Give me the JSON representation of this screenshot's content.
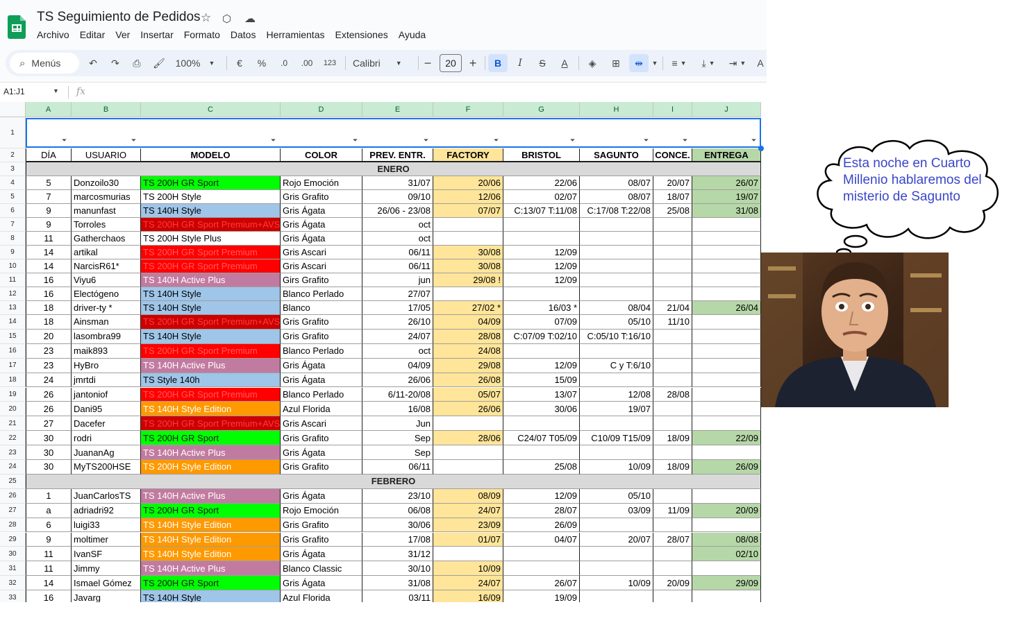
{
  "app": {
    "title": "TS Seguimiento de Pedidos",
    "menu": [
      "Archivo",
      "Editar",
      "Ver",
      "Insertar",
      "Formato",
      "Datos",
      "Herramientas",
      "Extensiones",
      "Ayuda"
    ]
  },
  "toolbar": {
    "search_label": "Menús",
    "zoom": "100%",
    "currency": "€",
    "percent": "%",
    "dec_decrease": ".0",
    "dec_increase": ".00",
    "number_format": "123",
    "font": "Calibri",
    "font_size": "20"
  },
  "formula_bar": {
    "name_box": "A1:J1",
    "fx": "fx"
  },
  "columns": [
    "A",
    "B",
    "C",
    "D",
    "E",
    "F",
    "G",
    "H",
    "I",
    "J"
  ],
  "headers": [
    "DÍA",
    "USUARIO",
    "MODELO",
    "COLOR",
    "PREV. ENTR.",
    "FACTORY",
    "BRISTOL",
    "SAGUNTO",
    "CONCE.",
    "ENTREGA"
  ],
  "row_numbers": [
    "1",
    "2",
    "3",
    "4",
    "5",
    "6",
    "7",
    "8",
    "9",
    "10",
    "11",
    "12",
    "13",
    "14",
    "15",
    "16",
    "17",
    "18",
    "19",
    "20",
    "21",
    "22",
    "23",
    "24",
    "25",
    "26",
    "27",
    "28",
    "29",
    "30",
    "31",
    "32",
    "33"
  ],
  "colors": {
    "green": "#00ff00",
    "red": "#ff0000",
    "darkred": "#cc0000",
    "blue": "#9fc5e8",
    "purple": "#c27ba0",
    "orange": "#ff9900",
    "factory": "#ffe599",
    "entrega": "#b6d7a8",
    "month": "#d9d9d9"
  },
  "months": {
    "enero": "ENERO",
    "febrero": "FEBRERO"
  },
  "rows": [
    {
      "r": 4,
      "dia": "5",
      "usuario": "Donzoilo30",
      "modelo": "TS 200H GR Sport",
      "m": "green",
      "color": "Rojo Emoción",
      "prev": "31/07",
      "factory": "20/06",
      "bristol": "22/06",
      "sagunto": "08/07",
      "conce": "20/07",
      "entrega": "26/07"
    },
    {
      "r": 5,
      "dia": "7",
      "usuario": "marcosmurias",
      "modelo": "TS 200H Style",
      "m": "",
      "color": "Gris Grafito",
      "prev": "09/10",
      "factory": "12/06",
      "bristol": "02/07",
      "sagunto": "08/07",
      "conce": "18/07",
      "entrega": "19/07"
    },
    {
      "r": 6,
      "dia": "9",
      "usuario": "manunfast",
      "modelo": "TS 140H Style",
      "m": "blue",
      "color": "Gris Ágata",
      "prev": "26/06 - 23/08",
      "factory": "07/07",
      "bristol": "C:13/07 T:11/08",
      "sagunto": "C:17/08 T:22/08",
      "conce": "25/08",
      "entrega": "31/08"
    },
    {
      "r": 7,
      "dia": "9",
      "usuario": "Torroles",
      "modelo": "TS 200H GR Sport Premium+AVS",
      "m": "darkred",
      "color": "Gris Ágata",
      "prev": "oct",
      "factory": "",
      "bristol": "",
      "sagunto": "",
      "conce": "",
      "entrega": ""
    },
    {
      "r": 8,
      "dia": "11",
      "usuario": "Gatherchaos",
      "modelo": "TS 200H Style Plus",
      "m": "",
      "color": "Gris Ágata",
      "prev": "oct",
      "factory": "",
      "bristol": "",
      "sagunto": "",
      "conce": "",
      "entrega": ""
    },
    {
      "r": 9,
      "dia": "14",
      "usuario": "artikal",
      "modelo": "TS 200H GR Sport Premium",
      "m": "red",
      "color": "Gris Ascari",
      "prev": "06/11",
      "factory": "30/08",
      "bristol": "12/09",
      "sagunto": "",
      "conce": "",
      "entrega": ""
    },
    {
      "r": 10,
      "dia": "14",
      "usuario": "NarcisR61*",
      "modelo": "TS 200H GR Sport Premium",
      "m": "red",
      "color": "Gris Ascari",
      "prev": "06/11",
      "factory": "30/08",
      "bristol": "12/09",
      "sagunto": "",
      "conce": "",
      "entrega": ""
    },
    {
      "r": 11,
      "dia": "16",
      "usuario": "Viyu6",
      "modelo": "TS 140H Active Plus",
      "m": "purple",
      "color": "Girs Grafito",
      "prev": "jun",
      "factory": "29/08 !",
      "bristol": "12/09",
      "sagunto": "",
      "conce": "",
      "entrega": ""
    },
    {
      "r": 12,
      "dia": "16",
      "usuario": "Electógeno",
      "modelo": "TS 140H Style",
      "m": "blue",
      "color": "Blanco Perlado",
      "prev": "27/07",
      "factory": "",
      "bristol": "",
      "sagunto": "",
      "conce": "",
      "entrega": ""
    },
    {
      "r": 13,
      "dia": "18",
      "usuario": "driver-ty *",
      "modelo": "TS 140H Style",
      "m": "blue",
      "color": "Blanco",
      "prev": "17/05",
      "factory": "27/02 *",
      "bristol": "16/03 *",
      "sagunto": "08/04",
      "conce": "21/04",
      "entrega": "26/04"
    },
    {
      "r": 14,
      "dia": "18",
      "usuario": "Ainsman",
      "modelo": "TS 200H GR Sport Premium+AVS",
      "m": "darkred",
      "color": "Gris Grafito",
      "prev": "26/10",
      "factory": "04/09",
      "bristol": "07/09",
      "sagunto": "05/10",
      "conce": "11/10",
      "entrega": ""
    },
    {
      "r": 15,
      "dia": "20",
      "usuario": "lasombra99",
      "modelo": "TS 140H Style",
      "m": "blue",
      "color": "Gris Grafito",
      "prev": "24/07",
      "factory": "28/08",
      "bristol": "C:07/09 T:02/10",
      "sagunto": "C:05/10 T:16/10",
      "conce": "",
      "entrega": ""
    },
    {
      "r": 16,
      "dia": "23",
      "usuario": "maik893",
      "modelo": "TS 200H GR Sport Premium",
      "m": "red",
      "color": "Blanco Perlado",
      "prev": "oct",
      "factory": "24/08",
      "bristol": "",
      "sagunto": "",
      "conce": "",
      "entrega": ""
    },
    {
      "r": 17,
      "dia": "23",
      "usuario": "HyBro",
      "modelo": "TS 140H Active Plus",
      "m": "purple",
      "color": "Gris Ágata",
      "prev": "04/09",
      "factory": "29/08",
      "bristol": "12/09",
      "sagunto": "C y T:6/10",
      "conce": "",
      "entrega": ""
    },
    {
      "r": 18,
      "dia": "24",
      "usuario": "jmrtdi",
      "modelo": "TS Style 140h",
      "m": "blue",
      "color": "Gris Ágata",
      "prev": "26/06",
      "factory": "26/08",
      "bristol": "15/09",
      "sagunto": "",
      "conce": "",
      "entrega": ""
    },
    {
      "r": 19,
      "dia": "26",
      "usuario": "jantoniof",
      "modelo": "TS 200H GR Sport Premium",
      "m": "red",
      "color": "Blanco Perlado",
      "prev": "6/11-20/08",
      "factory": "05/07",
      "bristol": "13/07",
      "sagunto": "12/08",
      "conce": "28/08",
      "entrega": ""
    },
    {
      "r": 20,
      "dia": "26",
      "usuario": "Dani95",
      "modelo": "TS 140H Style Edition",
      "m": "orange",
      "color": "Azul Florida",
      "prev": "16/08",
      "factory": "26/06",
      "bristol": "30/06",
      "sagunto": "19/07",
      "conce": "",
      "entrega": ""
    },
    {
      "r": 21,
      "dia": "27",
      "usuario": "Dacefer",
      "modelo": "TS 200H GR Sport Premium+AVS",
      "m": "darkred",
      "color": "Gris Ascari",
      "prev": "Jun",
      "factory": "",
      "bristol": "",
      "sagunto": "",
      "conce": "",
      "entrega": ""
    },
    {
      "r": 22,
      "dia": "30",
      "usuario": "rodri",
      "modelo": "TS 200H GR Sport",
      "m": "green",
      "color": "Gris Grafito",
      "prev": "Sep",
      "factory": "28/06",
      "bristol": "C24/07 T05/09",
      "sagunto": "C10/09 T15/09",
      "conce": "18/09",
      "entrega": "22/09"
    },
    {
      "r": 23,
      "dia": "30",
      "usuario": "JuananAg",
      "modelo": "TS 140H Active Plus",
      "m": "purple",
      "color": "Gris Ágata",
      "prev": "Sep",
      "factory": "",
      "bristol": "",
      "sagunto": "",
      "conce": "",
      "entrega": ""
    },
    {
      "r": 24,
      "dia": "30",
      "usuario": "MyTS200HSE",
      "modelo": "TS 200H Style Edition",
      "m": "orange",
      "color": "Gris Grafito",
      "prev": "06/11",
      "factory": "",
      "bristol": "25/08",
      "sagunto": "10/09",
      "conce": "18/09",
      "entrega": "26/09"
    },
    {
      "r": 26,
      "dia": "1",
      "usuario": "JuanCarlosTS",
      "modelo": "TS 140H Active Plus",
      "m": "purple",
      "color": "Gris Ágata",
      "prev": "23/10",
      "factory": "08/09",
      "bristol": "12/09",
      "sagunto": "05/10",
      "conce": "",
      "entrega": ""
    },
    {
      "r": 27,
      "dia": "a",
      "usuario": "adriadri92",
      "modelo": "TS 200H GR Sport",
      "m": "green",
      "color": "Rojo Emoción",
      "prev": "06/08",
      "factory": "24/07",
      "bristol": "28/07",
      "sagunto": "03/09",
      "conce": "11/09",
      "entrega": "20/09"
    },
    {
      "r": 28,
      "dia": "6",
      "usuario": "luigi33",
      "modelo": "TS 140H Style Edition",
      "m": "orange",
      "color": "Gris Grafito",
      "prev": "30/06",
      "factory": "23/09",
      "bristol": "26/09",
      "sagunto": "",
      "conce": "",
      "entrega": ""
    },
    {
      "r": 29,
      "dia": "9",
      "usuario": "moltimer",
      "modelo": "TS 140H Style Edition",
      "m": "orange",
      "color": "Gris Grafito",
      "prev": "17/08",
      "factory": "01/07",
      "bristol": "04/07",
      "sagunto": "20/07",
      "conce": "28/07",
      "entrega": "08/08"
    },
    {
      "r": 30,
      "dia": "11",
      "usuario": "IvanSF",
      "modelo": "TS 140H Style Edition",
      "m": "orange",
      "color": "Gris Ágata",
      "prev": "31/12",
      "factory": "",
      "bristol": "",
      "sagunto": "",
      "conce": "",
      "entrega": "02/10"
    },
    {
      "r": 31,
      "dia": "11",
      "usuario": "Jimmy",
      "modelo": "TS 140H Active Plus",
      "m": "purple",
      "color": "Blanco Classic",
      "prev": "30/10",
      "factory": "10/09",
      "bristol": "",
      "sagunto": "",
      "conce": "",
      "entrega": ""
    },
    {
      "r": 32,
      "dia": "14",
      "usuario": "Ismael Gómez",
      "modelo": "TS 200H GR Sport",
      "m": "green",
      "color": "Gris Ágata",
      "prev": "31/08",
      "factory": "24/07",
      "bristol": "26/07",
      "sagunto": "10/09",
      "conce": "20/09",
      "entrega": "29/09"
    },
    {
      "r": 33,
      "dia": "16",
      "usuario": "Javarg",
      "modelo": "TS 140H Style",
      "m": "blue",
      "color": "Azul Florida",
      "prev": "03/11",
      "factory": "16/09",
      "bristol": "19/09",
      "sagunto": "",
      "conce": "",
      "entrega": ""
    }
  ],
  "overlay": {
    "thought_bubble": "Esta noche en Cuarto Millenio hablaremos del misterio de Sagunto"
  }
}
